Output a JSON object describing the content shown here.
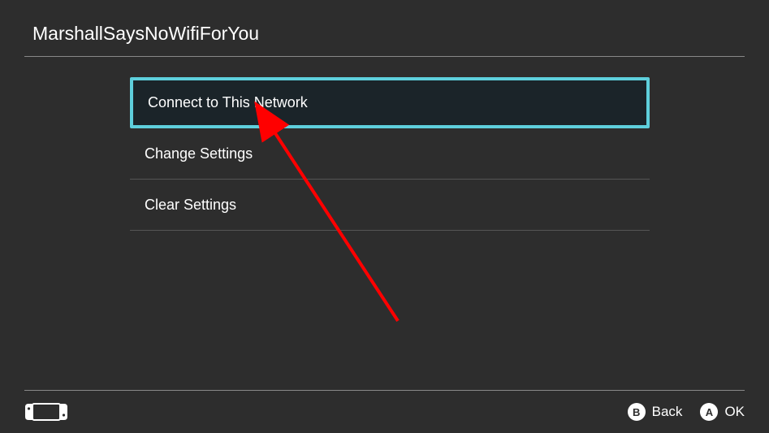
{
  "header": {
    "title": "MarshallSaysNoWifiForYou"
  },
  "menu": {
    "items": [
      {
        "label": "Connect to This Network",
        "selected": true
      },
      {
        "label": "Change Settings",
        "selected": false
      },
      {
        "label": "Clear Settings",
        "selected": false
      }
    ]
  },
  "footer": {
    "back_button_letter": "B",
    "back_label": "Back",
    "ok_button_letter": "A",
    "ok_label": "OK"
  }
}
